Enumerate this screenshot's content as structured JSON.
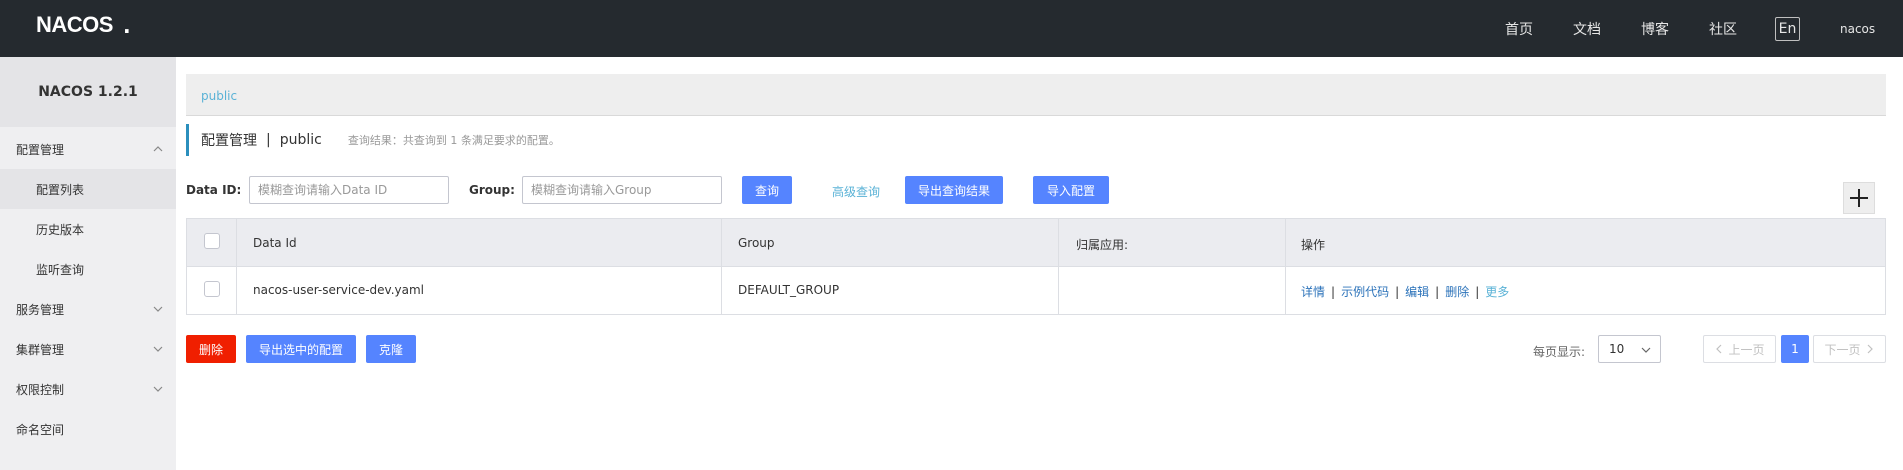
{
  "header": {
    "logo": "NACOS",
    "nav": [
      "首页",
      "文档",
      "博客",
      "社区"
    ],
    "lang": "En",
    "user": "nacos"
  },
  "sidebar": {
    "title": "NACOS 1.2.1",
    "items": [
      {
        "label": "配置管理",
        "level": "top",
        "chevron": "up"
      },
      {
        "label": "配置列表",
        "level": "sub",
        "active": true
      },
      {
        "label": "历史版本",
        "level": "sub"
      },
      {
        "label": "监听查询",
        "level": "sub"
      },
      {
        "label": "服务管理",
        "level": "top",
        "chevron": "down"
      },
      {
        "label": "集群管理",
        "level": "top",
        "chevron": "down"
      },
      {
        "label": "权限控制",
        "level": "top",
        "chevron": "down"
      },
      {
        "label": "命名空间",
        "level": "top"
      }
    ]
  },
  "namespace_bar": {
    "current": "public"
  },
  "page_header": {
    "title": "配置管理",
    "separator": "|",
    "namespace": "public",
    "summary": "查询结果：共查询到 1 条满足要求的配置。"
  },
  "filters": {
    "data_id_label": "Data ID:",
    "data_id_placeholder": "模糊查询请输入Data ID",
    "group_label": "Group:",
    "group_placeholder": "模糊查询请输入Group",
    "query_btn": "查询",
    "advanced_query": "高级查询",
    "export_results_btn": "导出查询结果",
    "import_btn": "导入配置"
  },
  "table": {
    "headers": [
      "Data Id",
      "Group",
      "归属应用:",
      "操作"
    ],
    "rows": [
      {
        "data_id": "nacos-user-service-dev.yaml",
        "group": "DEFAULT_GROUP",
        "app": ""
      }
    ],
    "operations": [
      "详情",
      "示例代码",
      "编辑",
      "删除",
      "更多"
    ]
  },
  "bulk_actions": {
    "delete": "删除",
    "export_selected": "导出选中的配置",
    "clone": "克隆"
  },
  "pagination": {
    "per_page_label": "每页显示:",
    "per_page": "10",
    "prev": "上一页",
    "current": "1",
    "next": "下一页"
  },
  "colors": {
    "topbar": "#252a2f",
    "primary": "#5584ff",
    "danger": "#f01f00",
    "link": "#2c73ba",
    "accent_link": "#5ab2d6"
  }
}
